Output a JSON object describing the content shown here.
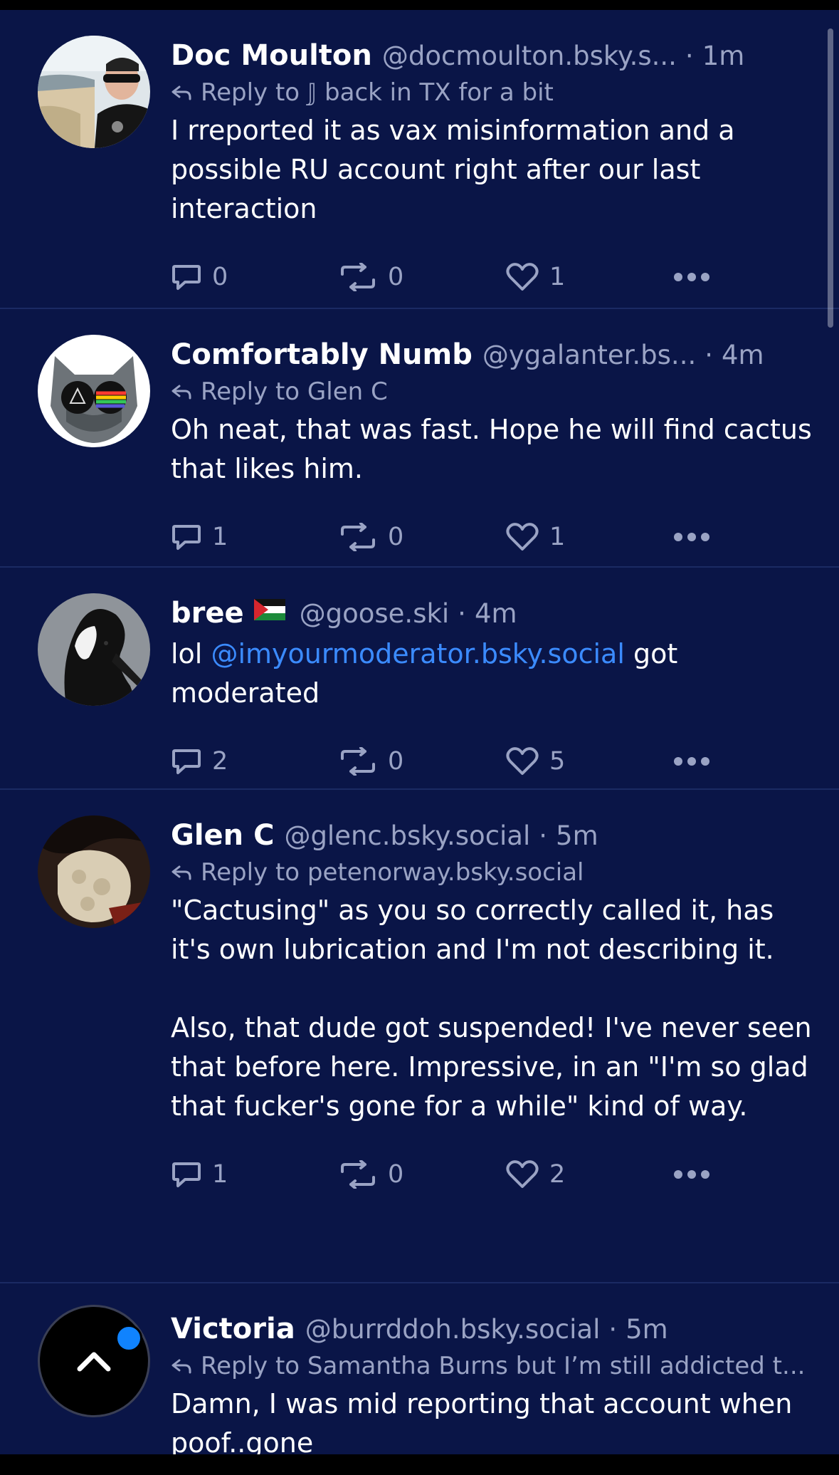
{
  "posts": [
    {
      "name": "Doc Moulton",
      "handle": "@docmoulton.bsky.s...",
      "time": "1m",
      "reply_to": "Reply to 𝕁 back in TX for a bit",
      "text": "I rreported it as vax misinformation and a possible RU account right after our last interaction",
      "replies": "0",
      "reposts": "0",
      "likes": "1"
    },
    {
      "name": "Comfortably Numb",
      "handle": "@ygalanter.bs...",
      "time": "4m",
      "reply_to": "Reply to Glen C",
      "text": "Oh neat, that was fast. Hope he will find cactus that likes him.",
      "replies": "1",
      "reposts": "0",
      "likes": "1"
    },
    {
      "name": "bree",
      "handle": "@goose.ski",
      "time": "4m",
      "text_prefix": "lol ",
      "mention": "@imyourmoderator.bsky.social",
      "text_suffix": " got moderated",
      "replies": "2",
      "reposts": "0",
      "likes": "5"
    },
    {
      "name": "Glen C",
      "handle": "@glenc.bsky.social",
      "time": "5m",
      "reply_to": "Reply to petenorway.bsky.social",
      "text": "\"Cactusing\" as you so correctly called it, has it's own lubrication and I'm not describing it.\n\nAlso, that dude got suspended! I've never seen that before here. Impressive, in an \"I'm so glad that fucker's gone for a while\" kind of way.",
      "replies": "1",
      "reposts": "0",
      "likes": "2"
    },
    {
      "name": "Victoria",
      "handle": "@burrddoh.bsky.social",
      "time": "5m",
      "reply_to": "Reply to Samantha Burns but I’m still addicted t...",
      "text": "Damn, I was mid reporting that account when poof..gone"
    }
  ],
  "separator": "·",
  "icons": {
    "reply": "reply-icon",
    "repost": "repost-icon",
    "like": "heart-icon",
    "more": "more-icon",
    "scroll_top": "chevron-up-icon"
  },
  "colors": {
    "background": "#0a1547",
    "accent": "#1083fe",
    "mention": "#3b8bff",
    "muted": "#9aa3c4"
  }
}
